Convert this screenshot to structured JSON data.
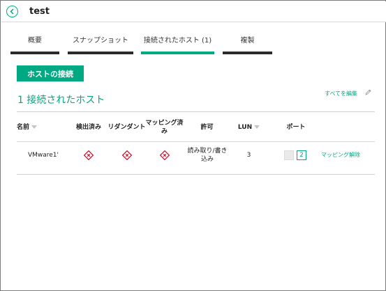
{
  "header": {
    "title": "test",
    "back_icon": "arrow-left-icon"
  },
  "tabs": [
    {
      "label": "概要",
      "active": false
    },
    {
      "label": "スナップショット",
      "active": false
    },
    {
      "label": "接続されたホスト (1)",
      "active": true
    },
    {
      "label": "複製",
      "active": false
    }
  ],
  "actions": {
    "connect_host_label": "ホストの接続",
    "edit_all_label": "すべてを編集"
  },
  "section": {
    "title": "1 接続されたホスト"
  },
  "table": {
    "columns": {
      "name": "名前",
      "detected": "検出済み",
      "redundant": "リダンダント",
      "mapped": "マッピング済み",
      "permission": "許可",
      "lun": "LUN",
      "port": "ポート"
    },
    "rows": [
      {
        "name": "VMware1'",
        "detected_status": "critical",
        "redundant_status": "critical",
        "mapped_status": "critical",
        "permission": "読み取り/書き込み",
        "lun": "3",
        "ports": [
          "",
          "2"
        ],
        "unmap_label": "マッピング解除"
      }
    ]
  },
  "colors": {
    "accent": "#01a982",
    "critical": "#d0112b",
    "tab_bar": "#2b2b2b"
  }
}
